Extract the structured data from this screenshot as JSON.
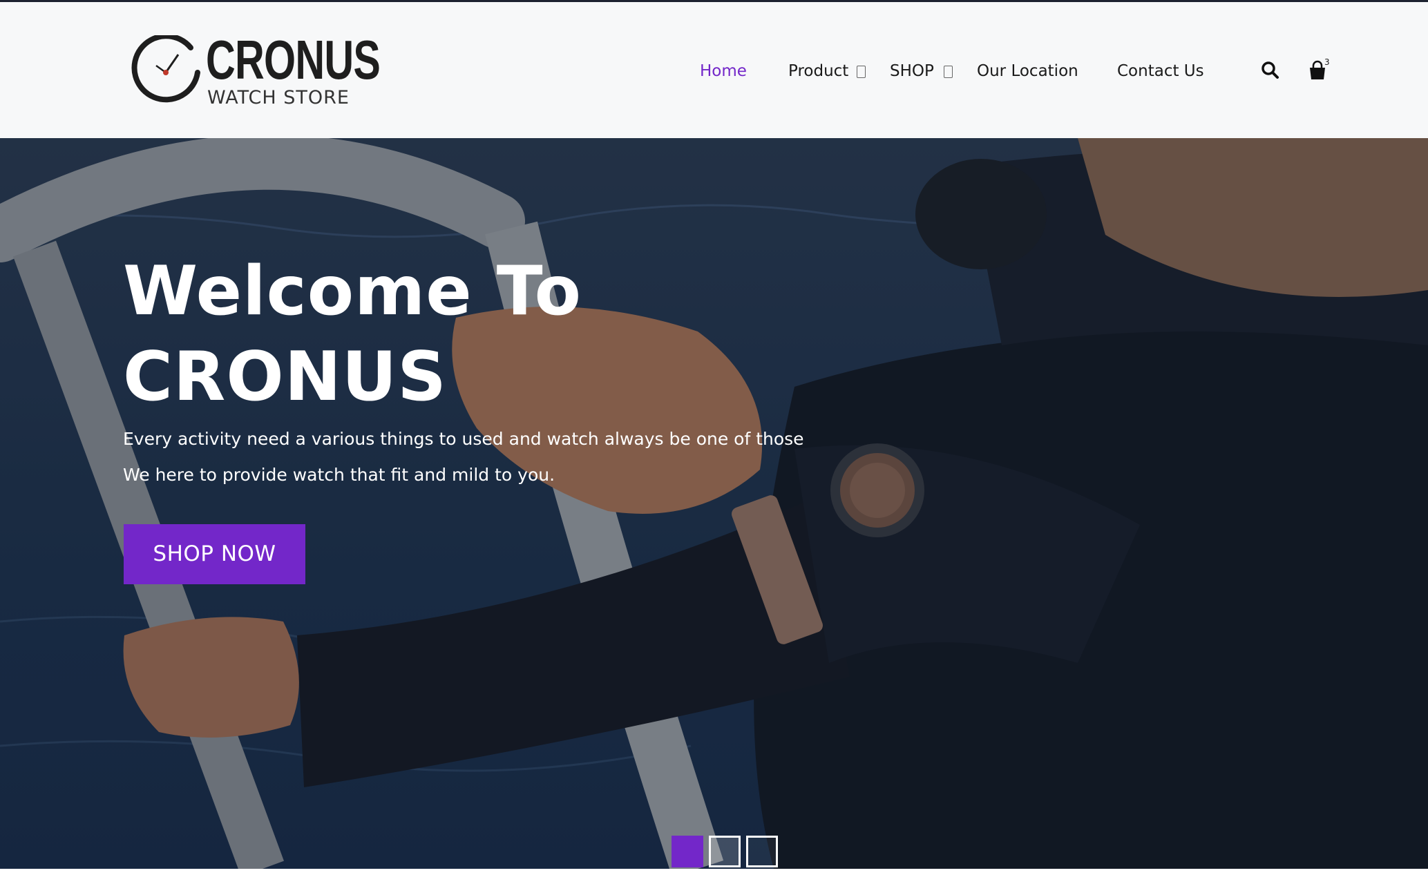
{
  "brand": {
    "name": "CRONUS",
    "subtitle": "WATCH STORE"
  },
  "nav": {
    "items": [
      {
        "label": "Home",
        "active": true
      },
      {
        "label": "Product",
        "has_dropdown": true
      },
      {
        "label": "SHOP",
        "has_dropdown": true
      },
      {
        "label": "Our Location"
      },
      {
        "label": "Contact Us"
      }
    ],
    "cart_count": "3",
    "icons": [
      "search-icon",
      "shopping-bag-icon"
    ]
  },
  "hero": {
    "title_line1": "Welcome To",
    "title_line2": "CRONUS",
    "text_line1": "Every activity need a various things to used and watch always be one of those",
    "text_line2": "We here to provide watch that fit and mild to you.",
    "button_label": "SHOP NOW",
    "slides_total": 3,
    "slide_active": 1
  },
  "colors": {
    "accent": "#7327c9",
    "header_bg": "#f7f8f9",
    "text_dark": "#1a1a1a",
    "hero_text": "#ffffff"
  }
}
